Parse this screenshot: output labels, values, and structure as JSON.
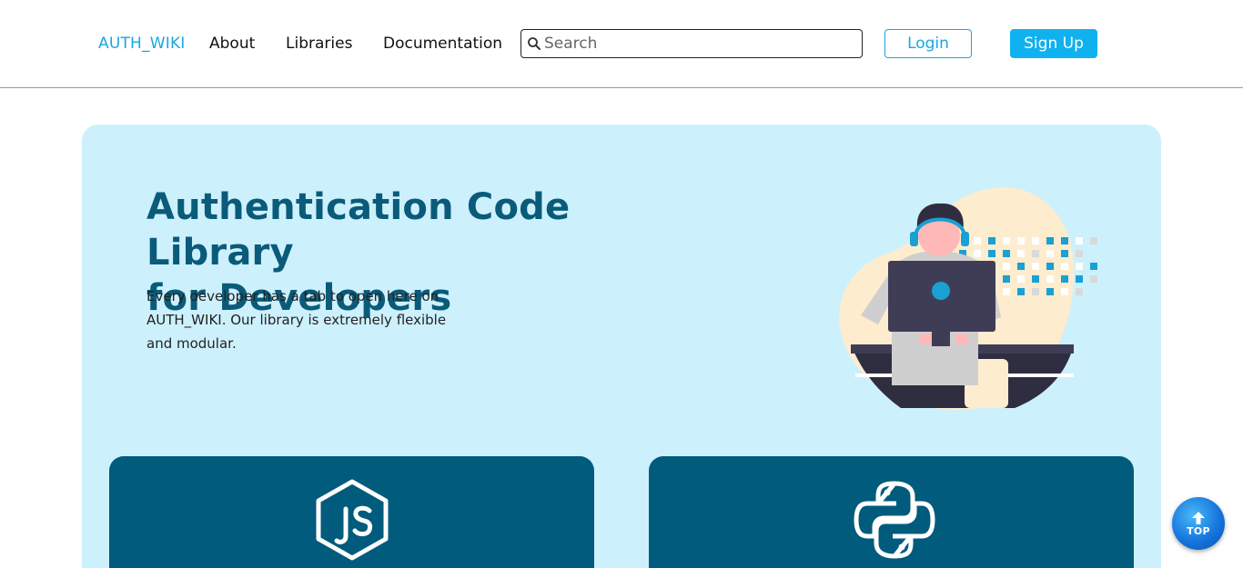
{
  "navbar": {
    "brand": "AUTH_WIKI",
    "links": [
      "About",
      "Libraries",
      "Documentation"
    ],
    "search": {
      "placeholder": "Search",
      "value": ""
    },
    "login_label": "Login",
    "signup_label": "Sign Up"
  },
  "hero": {
    "title_line1": "Authentication Code Library",
    "title_line2": "for Developers",
    "description": "Every developer has a tab to open here on AUTH_WIKI. Our library is extremely flexible and modular.",
    "illustration_icon": "developer-at-computer-illustration"
  },
  "libraries": [
    {
      "icon": "nodejs-icon"
    },
    {
      "icon": "python-icon"
    }
  ],
  "scroll_top": {
    "label": "TOP",
    "icon": "arrow-up-icon"
  },
  "colors": {
    "brand": "#19a7e0",
    "signup_bg": "#0fb2ee",
    "hero_bg": "#cdf0fd",
    "hero_title": "#0a5b7a",
    "card_bg": "#005b7c"
  }
}
